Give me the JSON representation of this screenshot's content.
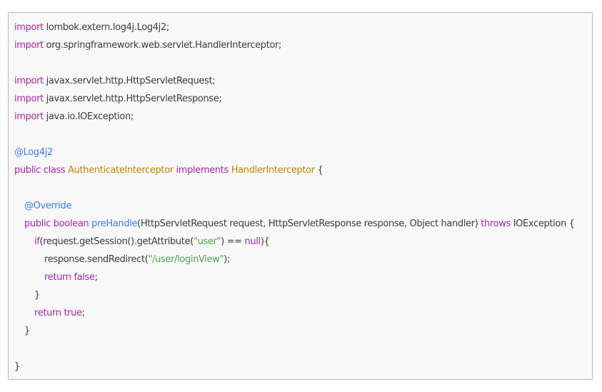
{
  "code": {
    "line1": {
      "kw": "import",
      "rest": " lombok.extern.log4j.Log4j2;"
    },
    "line2": {
      "kw": "import",
      "rest": " org.springframework.web.servlet.HandlerInterceptor;"
    },
    "line4": {
      "kw": "import",
      "rest": " javax.servlet.http.HttpServletRequest;"
    },
    "line5": {
      "kw": "import",
      "rest": " javax.servlet.http.HttpServletResponse;"
    },
    "line6": {
      "kw": "import",
      "rest": " java.io.IOException;"
    },
    "line8": {
      "annotation": "@Log4j2"
    },
    "line9": {
      "kw1": "public class",
      "type1": "AuthenticateInterceptor",
      "kw2": "implements",
      "type2": "HandlerInterceptor",
      "rest": " {"
    },
    "line11": {
      "annotation": "@Override"
    },
    "line12": {
      "kw1": "public boolean",
      "fn": "preHandle",
      "params": "(HttpServletRequest request, HttpServletResponse response, Object handler)",
      "kw2": "throws",
      "rest": " IOException {"
    },
    "line13": {
      "kw": "if",
      "pre": "(request.getSession().getAttribute(",
      "str": "\"user\"",
      "mid": ") == ",
      "lit": "null",
      "post": "){"
    },
    "line14": {
      "pre": "response.sendRedirect(",
      "str": "\"/user/loginView\"",
      "post": ");"
    },
    "line15": {
      "kw": "return",
      "lit": " false",
      "post": ";"
    },
    "line16": {
      "text": "}"
    },
    "line17": {
      "kw": "return",
      "lit": " true",
      "post": ";"
    },
    "line18": {
      "text": "}"
    },
    "line20": {
      "text": "}"
    }
  },
  "colors": {
    "keyword": "#a626a4",
    "annotation": "#4078f2",
    "type": "#c18401",
    "function": "#4078f2",
    "string": "#50a14f",
    "plain": "#3c3c3c",
    "background": "#f8f8f8"
  }
}
